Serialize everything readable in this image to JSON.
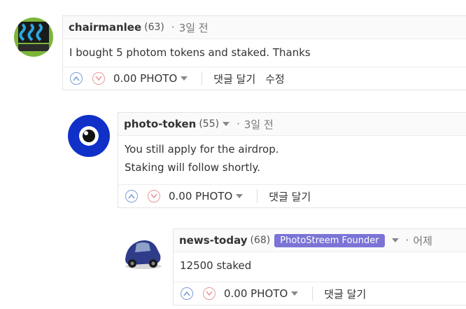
{
  "comments": [
    {
      "author": "chairmanlee",
      "reputation": "(63)",
      "time": "3일 전",
      "body": [
        "I bought 5 photom tokens and staked. Thanks"
      ],
      "payout": "0.00 PHOTO",
      "reply_label": "댓글 달기",
      "edit_label": "수정"
    },
    {
      "author": "photo-token",
      "reputation": "(55)",
      "time": "3일 전",
      "body": [
        "You still apply for the airdrop.",
        "Staking will follow shortly."
      ],
      "payout": "0.00 PHOTO",
      "reply_label": "댓글 달기"
    },
    {
      "author": "news-today",
      "reputation": "(68)",
      "badge": "PhotoStreem Founder",
      "time": "어제",
      "body": [
        "12500 staked"
      ],
      "payout": "0.00 PHOTO",
      "reply_label": "댓글 달기"
    }
  ],
  "colors": {
    "upvote": "#7b9ed6",
    "downvote": "#e69a9a",
    "badge": "#7b74d6"
  }
}
